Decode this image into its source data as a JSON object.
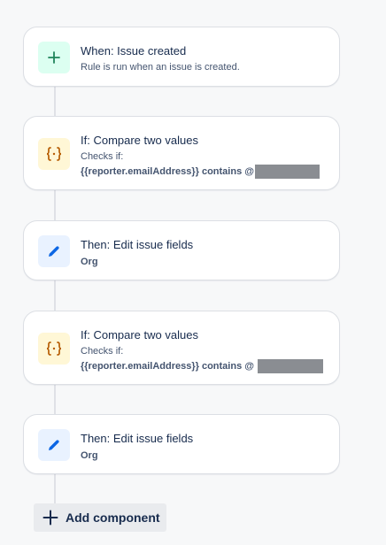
{
  "colors": {
    "trigger_bg": "#dcfff1",
    "trigger_fg": "#1f845a",
    "condition_bg": "#fff7d6",
    "condition_fg": "#b65c02",
    "action_bg": "#e9f2ff",
    "action_fg": "#0c66e4",
    "redaction": "#8a8d92"
  },
  "components": [
    {
      "type": "trigger",
      "icon": "plus-icon",
      "title": "When: Issue created",
      "subtitle": "Rule is run when an issue is created."
    },
    {
      "type": "condition",
      "icon": "braces-icon",
      "title": "If: Compare two values",
      "subtitle": "Checks if:",
      "condition": "{{reporter.emailAddress}} contains @"
    },
    {
      "type": "action",
      "icon": "pencil-icon",
      "title": "Then: Edit issue fields",
      "field": "Org"
    },
    {
      "type": "condition",
      "icon": "braces-icon",
      "title": "If: Compare two values",
      "subtitle": "Checks if:",
      "condition": "{{reporter.emailAddress}} contains @"
    },
    {
      "type": "action",
      "icon": "pencil-icon",
      "title": "Then: Edit issue fields",
      "field": "Org"
    }
  ],
  "add_component": {
    "label": "Add component",
    "icon": "plus-icon"
  }
}
